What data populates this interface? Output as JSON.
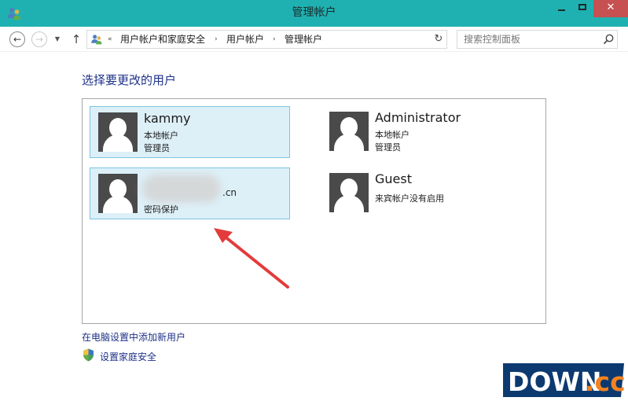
{
  "window": {
    "title": "管理帐户",
    "close_symbol": "✕"
  },
  "nav": {
    "back_symbol": "←",
    "forward_symbol": "→",
    "recent_symbol": "▼",
    "up_symbol": "↑",
    "refresh_symbol": "↻"
  },
  "address_bar": {
    "overflow": "«",
    "separator": "›",
    "crumbs": [
      "用户帐户和家庭安全",
      "用户帐户",
      "管理帐户"
    ]
  },
  "search": {
    "placeholder": "搜索控制面板"
  },
  "page": {
    "heading": "选择要更改的用户"
  },
  "accounts": [
    {
      "name": "kammy",
      "type": "本地帐户",
      "role": "管理员",
      "selected": true
    },
    {
      "name": "Administrator",
      "type": "本地帐户",
      "role": "管理员",
      "selected": false
    },
    {
      "name": "",
      "name_suffix": ".cn",
      "status": "密码保护",
      "selected": true
    },
    {
      "name": "Guest",
      "status": "来宾帐户没有启用",
      "selected": false
    }
  ],
  "links": {
    "add_user": "在电脑设置中添加新用户",
    "family_safety": "设置家庭安全"
  },
  "watermark": {
    "text": "DOWN.cc",
    "name_part": "DOWN",
    "suffix_part": ".cc"
  },
  "colors": {
    "titlebar": "#1fb1b1",
    "link": "#1e3287",
    "tile_highlight": "#ddf0f8",
    "arrow": "#e33b3b",
    "close_button": "#c75050"
  },
  "icons": [
    "user-accounts-icon",
    "back-arrow-icon",
    "forward-arrow-icon",
    "up-arrow-icon",
    "refresh-icon",
    "search-icon",
    "user-avatar-icon",
    "shield-icon",
    "red-arrow"
  ]
}
